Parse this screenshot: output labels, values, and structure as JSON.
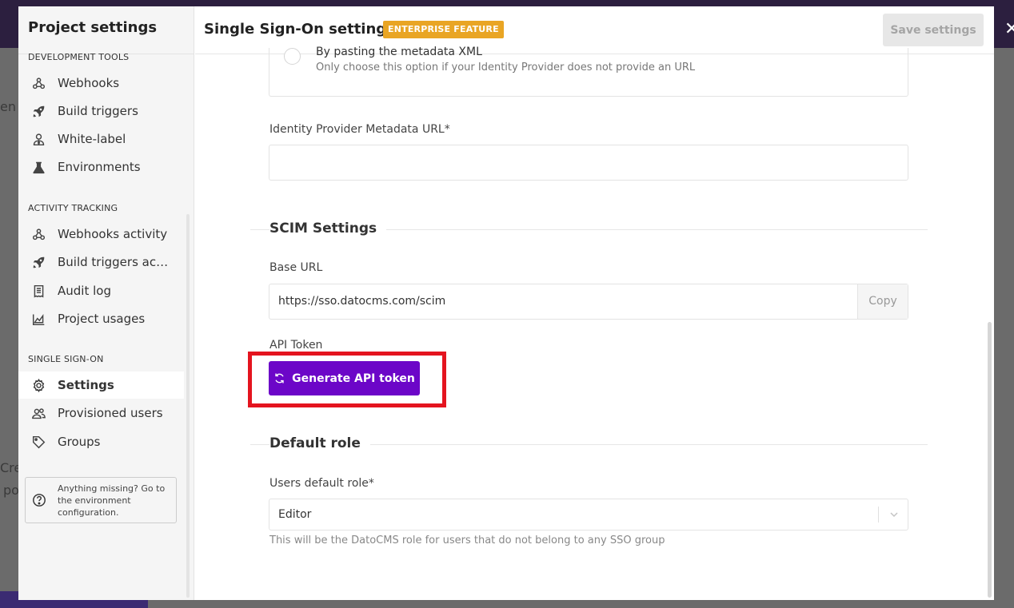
{
  "modal": {
    "sidebar_title": "Project settings",
    "sections": [
      {
        "label": "DEVELOPMENT TOOLS",
        "items": [
          {
            "label": "Webhooks",
            "icon": "webhook-icon"
          },
          {
            "label": "Build triggers",
            "icon": "rocket-icon"
          },
          {
            "label": "White-label",
            "icon": "user-tie-icon"
          },
          {
            "label": "Environments",
            "icon": "flask-icon"
          }
        ]
      },
      {
        "label": "ACTIVITY TRACKING",
        "items": [
          {
            "label": "Webhooks activity",
            "icon": "webhook-icon"
          },
          {
            "label": "Build triggers activity",
            "icon": "rocket-icon"
          },
          {
            "label": "Audit log",
            "icon": "receipt-icon"
          },
          {
            "label": "Project usages",
            "icon": "chart-area-icon"
          }
        ]
      },
      {
        "label": "SINGLE SIGN-ON",
        "items": [
          {
            "label": "Settings",
            "icon": "gear-icon",
            "active": true
          },
          {
            "label": "Provisioned users",
            "icon": "users-icon"
          },
          {
            "label": "Groups",
            "icon": "tag-icon"
          }
        ]
      }
    ],
    "help_text": "Anything missing? Go to the environment configuration.",
    "header": {
      "title": "Single Sign-On settings",
      "badge": "ENTERPRISE FEATURE",
      "save_label": "Save settings"
    },
    "metadata_option": {
      "title": "By pasting the metadata XML",
      "subtitle": "Only choose this option if your Identity Provider does not provide an URL"
    },
    "idp_url": {
      "label": "Identity Provider Metadata URL*",
      "value": ""
    },
    "scim": {
      "title": "SCIM Settings",
      "base_url_label": "Base URL",
      "base_url_value": "https://sso.datocms.com/scim",
      "copy_label": "Copy",
      "api_token_label": "API Token",
      "generate_label": "Generate API token"
    },
    "default_role": {
      "title": "Default role",
      "label": "Users default role*",
      "value": "Editor",
      "hint": "This will be the DatoCMS role for users that do not belong to any SSO group"
    }
  }
}
